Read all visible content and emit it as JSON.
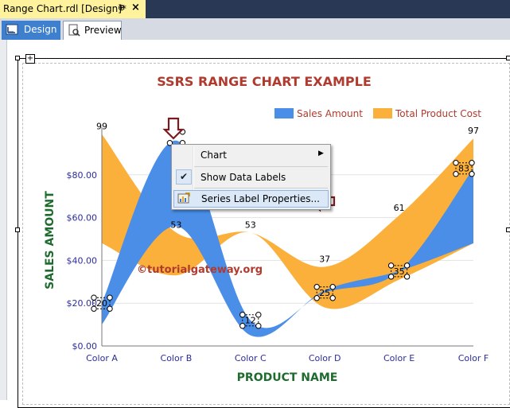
{
  "document_tab": {
    "title": "Range Chart.rdl [Design]*",
    "pin_glyph": "⊕",
    "close_glyph": "×"
  },
  "view_tabs": [
    {
      "label": "Design",
      "icon": "design-ruler-icon",
      "active": true
    },
    {
      "label": "Preview",
      "icon": "preview-icon",
      "active": false
    }
  ],
  "context_menu": {
    "items": [
      {
        "label": "Chart",
        "has_submenu": true
      },
      {
        "label": "Show Data Labels",
        "checked": true
      },
      {
        "label": "Series Label Properties...",
        "highlighted": true,
        "icon": "series-properties-icon"
      }
    ]
  },
  "colors": {
    "sales": "#4a8ee8",
    "cost": "#fbb03b",
    "title": "#b03a2e",
    "axis_title": "#1e6b2e",
    "tick": "#2c2c9a",
    "watermark": "#b03a2e",
    "annotation_arrow": "#7a1b20"
  },
  "watermark": "©tutorialgateway.org",
  "chart_data": {
    "type": "area",
    "subtype": "smooth range",
    "title": "SSRS RANGE CHART EXAMPLE",
    "xlabel": "PRODUCT NAME",
    "ylabel": "SALES AMOUNT",
    "categories": [
      "Color A",
      "Color B",
      "Color C",
      "Color D",
      "Color E",
      "Color F"
    ],
    "ylim": [
      0,
      100
    ],
    "yticks": [
      "$0.00",
      "$20.00",
      "$40.00",
      "$60.00",
      "$80.00"
    ],
    "ytick_values": [
      0,
      20,
      40,
      60,
      80
    ],
    "grid": true,
    "legend_position": "top-right",
    "series": [
      {
        "name": "Sales Amount",
        "low": [
          10,
          56,
          5,
          26,
          35,
          48
        ],
        "high": [
          20,
          96,
          12,
          25,
          35,
          83
        ],
        "labels": [
          "20",
          "",
          "12",
          "25",
          "35",
          "83"
        ]
      },
      {
        "name": "Total Product Cost",
        "low": [
          48,
          33,
          53,
          18,
          31,
          48
        ],
        "high": [
          99,
          53,
          53,
          37,
          61,
          97
        ],
        "labels": [
          "99",
          "53",
          "53",
          "37",
          "61",
          "97"
        ]
      }
    ]
  }
}
